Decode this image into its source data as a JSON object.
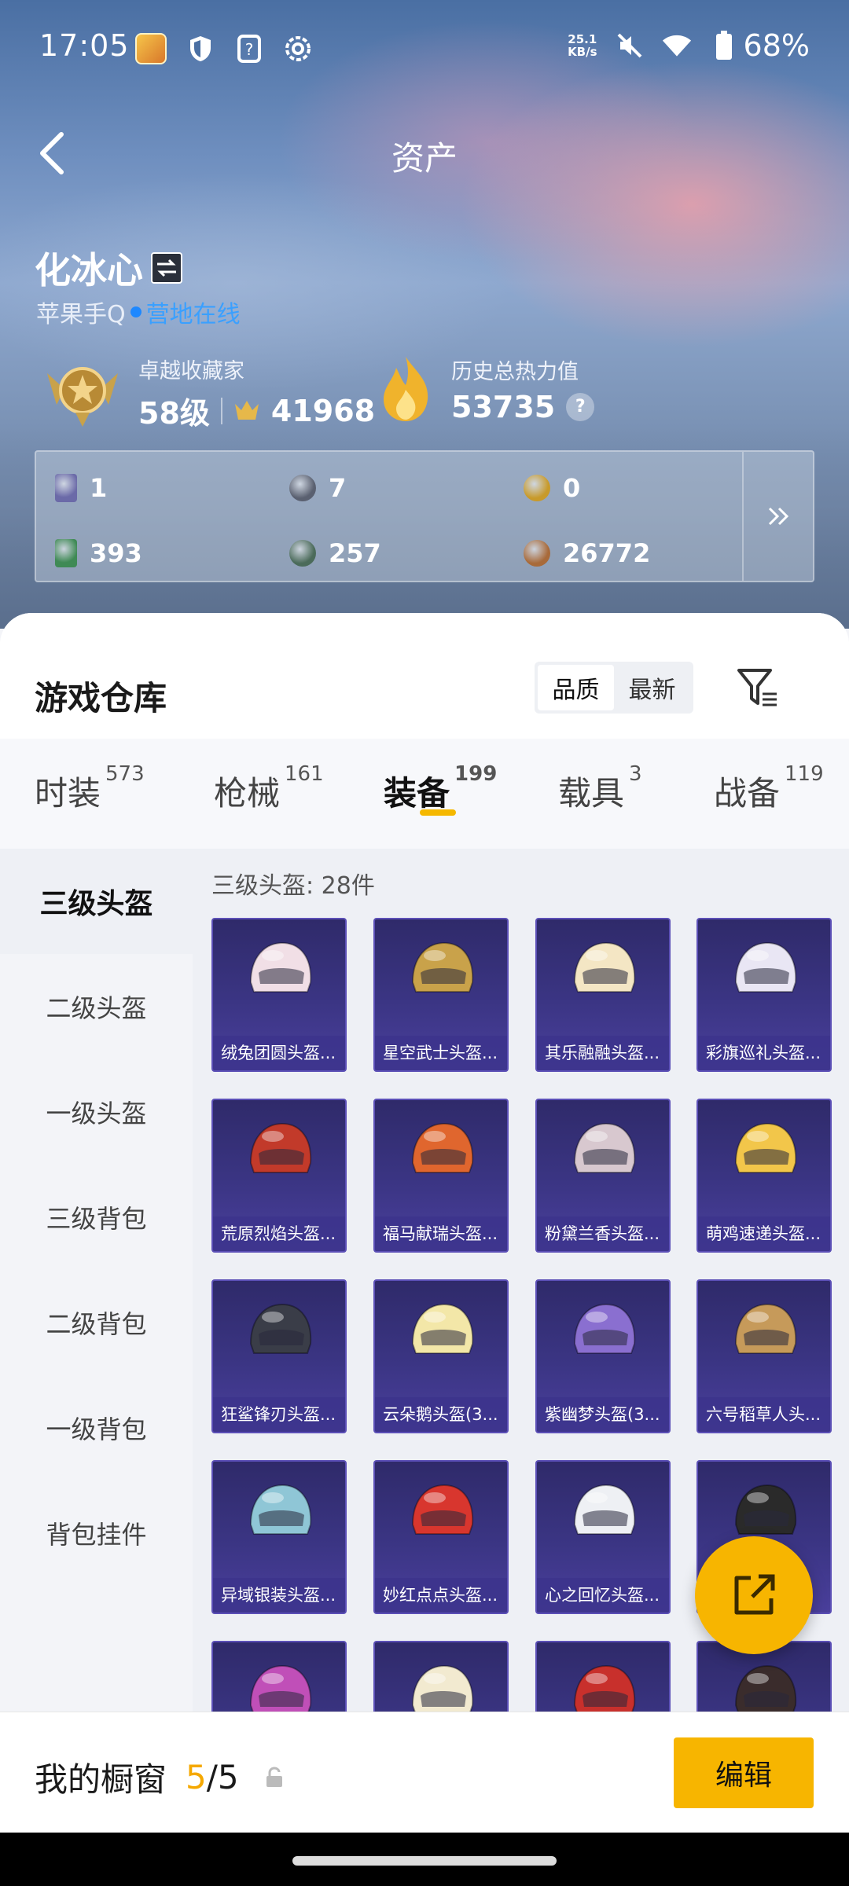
{
  "status_bar": {
    "time": "17:05",
    "net_speed_value": "25.1",
    "net_speed_unit": "KB/s",
    "battery": "68%"
  },
  "nav": {
    "title": "资产"
  },
  "profile": {
    "name": "化冰心",
    "platform": "苹果手Q",
    "online_status": "营地在线"
  },
  "collector": {
    "label": "卓越收藏家",
    "level": "58级",
    "points": "41968"
  },
  "heat": {
    "label": "历史总热力值",
    "value": "53735",
    "help": "?"
  },
  "currencies": [
    {
      "value": "1",
      "color": "#6b6aa8"
    },
    {
      "value": "7",
      "color": "#5a6070"
    },
    {
      "value": "0",
      "color": "#c89a2a"
    },
    {
      "value": "393",
      "color": "#3f8a55"
    },
    {
      "value": "257",
      "color": "#4b6b5a"
    },
    {
      "value": "26772",
      "color": "#a86a3a"
    }
  ],
  "warehouse": {
    "title": "游戏仓库",
    "sort_options": [
      "品质",
      "最新"
    ],
    "active_sort": "品质"
  },
  "tabs": [
    {
      "label": "时装",
      "count": "573"
    },
    {
      "label": "枪械",
      "count": "161"
    },
    {
      "label": "装备",
      "count": "199"
    },
    {
      "label": "载具",
      "count": "3"
    },
    {
      "label": "战备",
      "count": "119"
    }
  ],
  "active_tab": "装备",
  "sidebar": [
    {
      "label": "三级头盔"
    },
    {
      "label": "二级头盔"
    },
    {
      "label": "一级头盔"
    },
    {
      "label": "三级背包"
    },
    {
      "label": "二级背包"
    },
    {
      "label": "一级背包"
    },
    {
      "label": "背包挂件"
    }
  ],
  "grid": {
    "heading": "三级头盔: 28件",
    "items": [
      {
        "name": "绒兔团圆头盔...",
        "color": "#f1dfe6"
      },
      {
        "name": "星空武士头盔...",
        "color": "#c9a24a"
      },
      {
        "name": "其乐融融头盔...",
        "color": "#f4e6c4"
      },
      {
        "name": "彩旗巡礼头盔...",
        "color": "#e9e6f4"
      },
      {
        "name": "荒原烈焰头盔...",
        "color": "#c23a2a"
      },
      {
        "name": "福马献瑞头盔...",
        "color": "#e0662e"
      },
      {
        "name": "粉黛兰香头盔...",
        "color": "#d8c8cf"
      },
      {
        "name": "萌鸡速递头盔...",
        "color": "#f2c64a"
      },
      {
        "name": "狂鲨锋刃头盔...",
        "color": "#3a3d48"
      },
      {
        "name": "云朵鹅头盔(3...",
        "color": "#f3e7a8"
      },
      {
        "name": "紫幽梦头盔(3...",
        "color": "#8a6fd0"
      },
      {
        "name": "六号稻草人头...",
        "color": "#c69a5a"
      },
      {
        "name": "异域银装头盔...",
        "color": "#8fc6d6"
      },
      {
        "name": "妙红点点头盔...",
        "color": "#d8362e"
      },
      {
        "name": "心之回忆头盔...",
        "color": "#eef0f4"
      },
      {
        "name": "",
        "color": "#2a2a2a"
      },
      {
        "name": "",
        "color": "#c04fb8"
      },
      {
        "name": "",
        "color": "#f2ead0"
      },
      {
        "name": "",
        "color": "#c8302c"
      },
      {
        "name": "",
        "color": "#3a2c2c"
      }
    ]
  },
  "showcase": {
    "label": "我的橱窗",
    "count": "5",
    "total": "/5",
    "edit": "编辑"
  }
}
